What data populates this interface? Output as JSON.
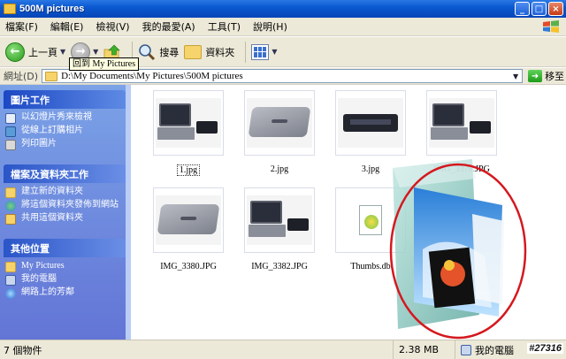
{
  "window": {
    "title": "500M pictures"
  },
  "window_controls": {
    "minimize": "_",
    "maximize": "□",
    "close": "×"
  },
  "menu": {
    "items": [
      "檔案(F)",
      "編輯(E)",
      "檢視(V)",
      "我的最愛(A)",
      "工具(T)",
      "說明(H)"
    ]
  },
  "toolbar": {
    "back_label": "上一頁",
    "search_label": "搜尋",
    "folders_label": "資料夾"
  },
  "tooltip": {
    "text": "回到 My Pictures"
  },
  "address": {
    "label": "網址(D)",
    "path": "D:\\My Documents\\My Pictures\\500M pictures",
    "go_label": "移至"
  },
  "taskpane": {
    "sections": [
      {
        "title": "圖片工作",
        "items": [
          "以幻燈片秀來檢視",
          "從線上訂購相片",
          "列印圖片"
        ]
      },
      {
        "title": "檔案及資料夾工作",
        "items": [
          "建立新的資料夾",
          "將這個資料夾發佈到網站",
          "共用這個資料夾"
        ]
      },
      {
        "title": "其他位置",
        "items": [
          "My Pictures",
          "我的電腦",
          "網路上的芳鄰"
        ]
      }
    ]
  },
  "files": [
    {
      "name": "1.jpg",
      "kind": "laptop-open"
    },
    {
      "name": "2.jpg",
      "kind": "laptop-closed"
    },
    {
      "name": "3.jpg",
      "kind": "dock"
    },
    {
      "name": "IMG_3378.JPG",
      "kind": "laptop-open"
    },
    {
      "name": "IMG_3380.JPG",
      "kind": "laptop-closed"
    },
    {
      "name": "IMG_3382.JPG",
      "kind": "laptop-open"
    },
    {
      "name": "Thumbs.db",
      "kind": "db"
    }
  ],
  "status": {
    "count": "7 個物件",
    "size": "2.38 MB",
    "zone": "我的電腦"
  },
  "watermark": "#27316",
  "colors": {
    "title_bar": "#0a58d0",
    "task_pane": "#6e8fe0",
    "highlight_circle": "#d4191f"
  }
}
